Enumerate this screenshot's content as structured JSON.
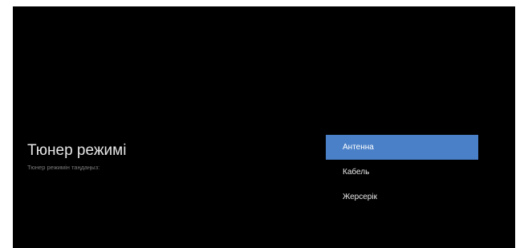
{
  "screen": {
    "title": "Тюнер режимі",
    "subtitle": "Тюнер режимін таңдаңыз:"
  },
  "options": [
    {
      "label": "Антенна",
      "selected": true
    },
    {
      "label": "Кабель",
      "selected": false
    },
    {
      "label": "Жерсерік",
      "selected": false
    }
  ],
  "colors": {
    "background": "#000000",
    "selection": "#4a80c8",
    "text": "#e8e8e8",
    "subtext": "#7a7a7a"
  }
}
